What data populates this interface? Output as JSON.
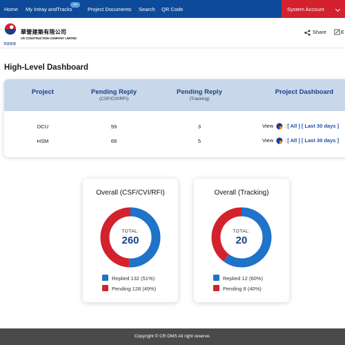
{
  "nav": {
    "items": [
      "Home",
      "My Intray andTracks",
      "Project Documents",
      "Search",
      "QR Code"
    ],
    "badge": "•••",
    "system_account": "System Account"
  },
  "brand": {
    "name_cn": "華營建築有限公司",
    "name_en": "CR CONSTRUCTION COMPANY LIMITED",
    "logo_sub": "潤建集團"
  },
  "toolbar": {
    "share_label": "Share",
    "second_label": "E"
  },
  "page": {
    "title": "High-Level Dashboard"
  },
  "table": {
    "headers": {
      "project": "Project",
      "pending1": "Pending Reply",
      "pending1_sub": "(CSF/CVI/RFI)",
      "pending2": "Pending Reply",
      "pending2_sub": "(Tracking)",
      "dashboard": "Project Dashboard"
    },
    "view_label": "View",
    "all_label": "[ All ]",
    "last30_label": "[ Last 30 days ]",
    "rows": [
      {
        "project": "DCU",
        "csf": "59",
        "tracking": "3"
      },
      {
        "project": "HSM",
        "csf": "69",
        "tracking": "5"
      }
    ]
  },
  "charts": [
    {
      "title": "Overall (CSF/CVI/RFI)",
      "total_label": "TOTAL:",
      "total": "260",
      "legend": [
        "Replied 132 (51%)",
        "Pending 128 (49%)"
      ]
    },
    {
      "title": "Overall (Tracking)",
      "total_label": "TOTAL:",
      "total": "20",
      "legend": [
        "Replied 12 (60%)",
        "Pending 8 (40%)"
      ]
    }
  ],
  "chart_data": [
    {
      "type": "pie",
      "title": "Overall (CSF/CVI/RFI)",
      "categories": [
        "Replied",
        "Pending"
      ],
      "values": [
        132,
        128
      ],
      "colors": [
        "#1f73c8",
        "#d3222e"
      ]
    },
    {
      "type": "pie",
      "title": "Overall (Tracking)",
      "categories": [
        "Replied",
        "Pending"
      ],
      "values": [
        12,
        8
      ],
      "colors": [
        "#1f73c8",
        "#d3222e"
      ]
    }
  ],
  "colors": {
    "nav": "#0d4b9a",
    "accent_red": "#d3222e",
    "replied_blue": "#1f73c8",
    "header_bg": "#c8d7ea"
  },
  "footer": {
    "text": "Copyright © CR DMS All right reserve."
  }
}
